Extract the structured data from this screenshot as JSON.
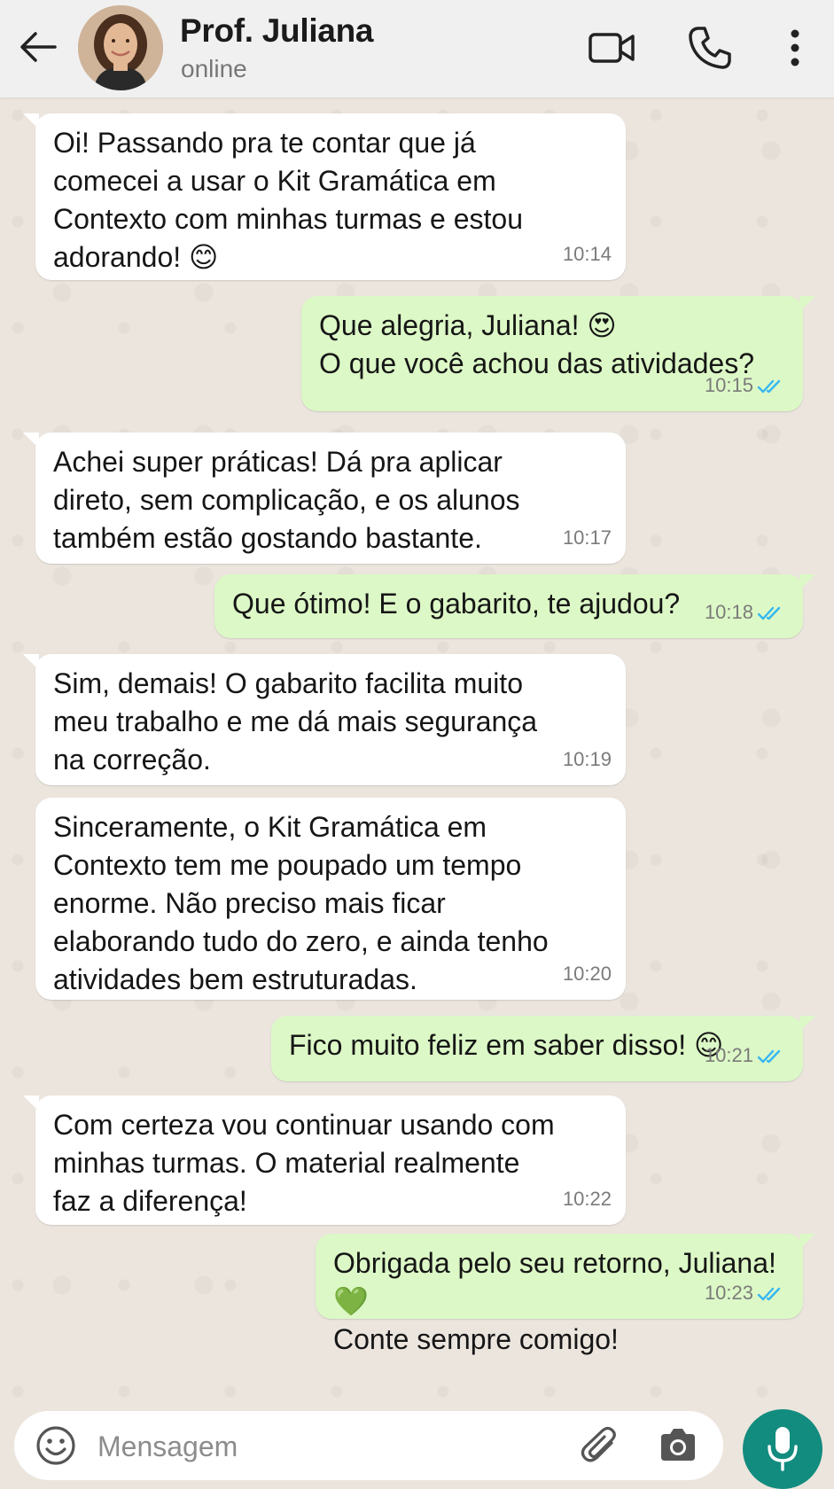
{
  "header": {
    "name": "Prof. Juliana",
    "status": "online"
  },
  "messages": [
    {
      "side": "in",
      "text": "Oi! Passando pra te contar que já\ncomecei a usar o Kit Gramática em\nContexto com minhas turmas e estou\nadorando! 😊",
      "time": "10:14"
    },
    {
      "side": "out",
      "text": "Que alegria, Juliana! 😍\nO que você achou das atividades?",
      "time": "10:15",
      "read": true
    },
    {
      "side": "in",
      "text": "Achei super práticas! Dá pra aplicar\ndireto, sem complicação, e os alunos\ntambém estão gostando bastante.",
      "time": "10:17"
    },
    {
      "side": "out",
      "text": "Que ótimo! E o gabarito, te ajudou?",
      "time": "10:18",
      "read": true
    },
    {
      "side": "in",
      "text": "Sim, demais! O gabarito facilita muito\nmeu trabalho e me dá mais segurança\nna correção.",
      "time": "10:19"
    },
    {
      "side": "in",
      "text": "Sinceramente, o Kit Gramática em\nContexto tem me poupado um tempo\nenorme. Não preciso mais ficar\nelaborando tudo do zero, e ainda tenho\natividades bem estruturadas.",
      "time": "10:20"
    },
    {
      "side": "out",
      "text": "Fico muito feliz em saber disso! 😊",
      "time": "10:21",
      "read": true
    },
    {
      "side": "in",
      "text": "Com certeza vou continuar usando com\nminhas turmas. O material realmente\nfaz a diferença!",
      "time": "10:22"
    },
    {
      "side": "out",
      "text": "Obrigada pelo seu retorno, Juliana! 💚\nConte sempre comigo!",
      "time": "10:23",
      "read": true
    }
  ],
  "input": {
    "placeholder": "Mensagem"
  },
  "colors": {
    "outgoing_bubble": "#dcf8c6",
    "incoming_bubble": "#ffffff",
    "read_check": "#34b7f1",
    "accent": "#128c7e"
  },
  "icons": [
    "back-arrow-icon",
    "video-call-icon",
    "phone-icon",
    "more-options-icon",
    "emoji-icon",
    "attach-icon",
    "camera-icon",
    "mic-icon",
    "double-check-icon"
  ]
}
